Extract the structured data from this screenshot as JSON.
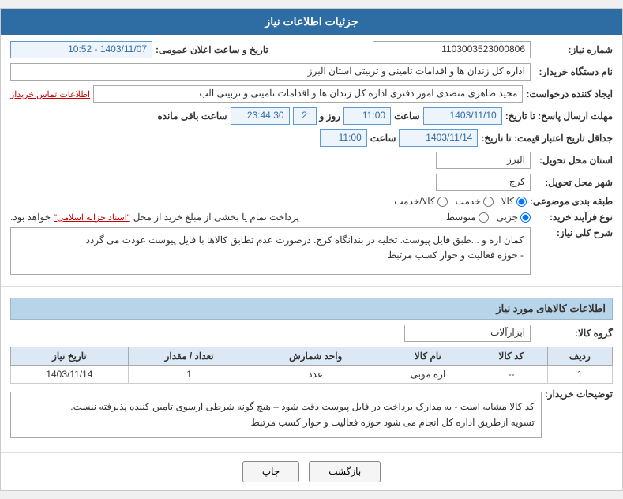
{
  "header": {
    "title": "جزئیات اطلاعات نیاز"
  },
  "fields": {
    "shomara_niaz_label": "شماره نیاز:",
    "shomara_niaz_value": "1103003523000806",
    "name_dastgah_label": "نام دستگاه خریدار:",
    "name_dastgah_value": "اداره کل زندان ها و اقدامات تامینی و تربیتی استان البرز",
    "eijad_label": "ایجاد کننده درخواست:",
    "eijad_value": "مجید طاهری متصدی امور دفتری اداره کل زندان ها و اقدامات تامینی و تربیتی الب",
    "eijad_link": "اطلاعات تماس خریدار",
    "mohlat_label": "مهلت ارسال پاسخ: تا تاریخ:",
    "mohlat_date": "1403/11/10",
    "mohlat_time": "11:00",
    "mohlat_roz": "2",
    "mohlat_saaat": "23:44:30",
    "mohlat_suffix": "ساعت باقی مانده",
    "jadaval_label": "جداقل تاریخ اعتبار قیمت: تا تاریخ:",
    "jadaval_date": "1403/11/14",
    "jadaval_time": "11:00",
    "ostan_label": "استان محل تحویل:",
    "ostan_value": "البرز",
    "shahr_label": "شهر محل تحویل:",
    "shahr_value": "کرج",
    "tabaghe_label": "طبقه بندی موضوعی:",
    "tabaghe_options": [
      "کالا",
      "خدمت",
      "کالا/خدمت"
    ],
    "tabaghe_selected": "کالا",
    "tarikh_label": "تاریخ و ساعت اعلان عمومی:",
    "tarikh_value": "1403/11/07 - 10:52",
    "noe_farayand_label": "نوع فرآیند خرید:",
    "noe_options": [
      "جزیی",
      "متوسط"
    ],
    "noe_selected": "جزیی",
    "pardakht_text": "پرداخت تمام یا بخشی از مبلغ خرید از محل",
    "sandad_link": "\"اسناد خزانه اسلامی\"",
    "pardakht_suffix": "خواهد بود.",
    "sharh_label": "شرح کلی نیاز:",
    "sharh_text1": "کمان اره و ...طبق فایل پیوست. تخلیه در بندانگاه کرج. درصورت عدم تطابق کالاها با فایل پیوست عودت می گردد",
    "sharh_text2": "- حوزه فعالیت و حوار کسب مرتبط",
    "kalainfo_title": "اطلاعات کالاهای مورد نیاز",
    "group_label": "گروه کالا:",
    "group_value": "ابزارآلات",
    "table_headers": [
      "ردیف",
      "کد کالا",
      "نام کالا",
      "واحد شمارش",
      "تعداد / مقدار",
      "تاریخ نیاز"
    ],
    "table_rows": [
      {
        "radif": "1",
        "kod": "--",
        "name": "اره موبی",
        "vahed": "عدد",
        "tedad": "1",
        "tarikh": "1403/11/14"
      }
    ],
    "desc_box_text": "کد کالا مشابه است - به مدارک برداخت در فایل پیوست دقت شود – هیچ گونه شرطی ارسوی تامین کننده پذیرفته نیست.",
    "desc_box_text2": "تسویه ازطریق اداره کل انجام می شود حوزه فعالیت و حوار کسب مرتبط",
    "buyer_desc_label": "توضیحات خریدار:",
    "btn_print": "چاپ",
    "btn_back": "بازگشت"
  }
}
